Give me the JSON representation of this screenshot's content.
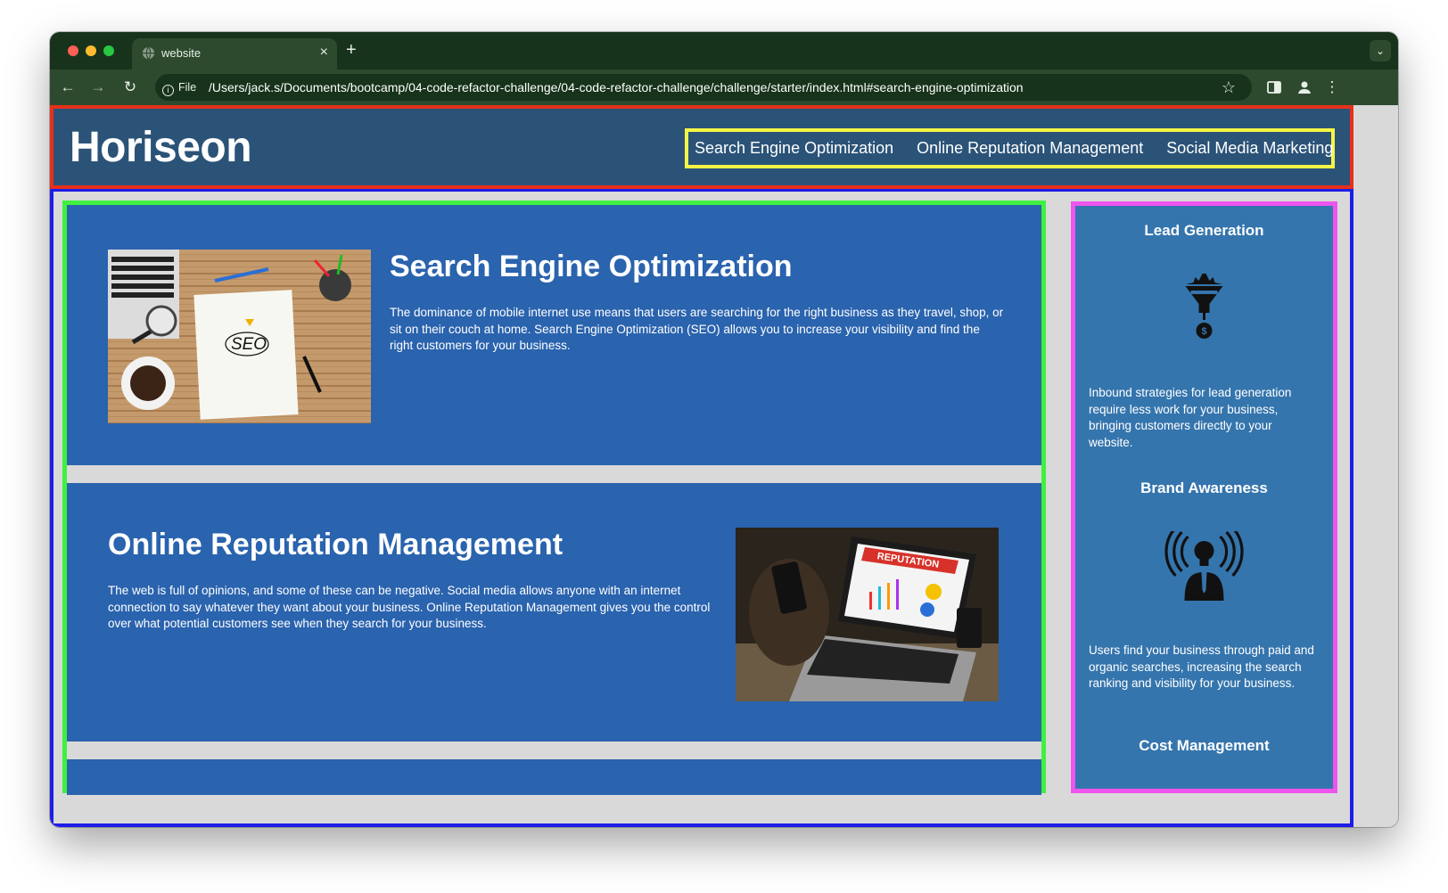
{
  "browser": {
    "tab_title": "website",
    "tab_close": "×",
    "new_tab": "+",
    "tab_menu": "⌄",
    "back": "←",
    "forward": "→",
    "reload": "↻",
    "file_label": "File",
    "url": "/Users/jack.s/Documents/bootcamp/04-code-refactor-challenge/04-code-refactor-challenge/challenge/starter/index.html#search-engine-optimization",
    "bookmark": "☆",
    "menu": "⋮",
    "theme": "#2d4a2e"
  },
  "header": {
    "logo": "Horiseon",
    "nav": [
      "Search Engine Optimization",
      "Online Reputation Management",
      "Social Media Marketing"
    ],
    "outline_color": "#e63019",
    "nav_outline_color": "#f5f545"
  },
  "content": {
    "sections": [
      {
        "title": "Search Engine Optimization",
        "text": "The dominance of mobile internet use means that users are searching for the right business as they travel, shop, or sit on their couch at home. Search Engine Optimization (SEO) allows you to increase your visibility and find the right customers for your business.",
        "image": "seo-notebook-image"
      },
      {
        "title": "Online Reputation Management",
        "text": "The web is full of opinions, and some of these can be negative. Social media allows anyone with an internet connection to say whatever they want about your business. Online Reputation Management gives you the control over what potential customers see when they search for your business.",
        "image": "reputation-laptop-image",
        "image_label": "REPUTATION"
      }
    ],
    "outline_color": "#40f040",
    "section_color": "#2a63ae"
  },
  "aside": {
    "benefits": [
      {
        "title": "Lead Generation",
        "icon": "lead-funnel-icon",
        "text": "Inbound strategies for lead generation require less work for your business, bringing customers directly to your website."
      },
      {
        "title": "Brand Awareness",
        "icon": "brand-broadcast-icon",
        "text": "Users find your business through paid and organic searches, increasing the search ranking and visibility for your business."
      },
      {
        "title": "Cost Management",
        "icon": "",
        "text": ""
      }
    ],
    "outline_color": "#ee55ee",
    "background": "#3575ad"
  },
  "page_outline_color": "#1d1de8"
}
